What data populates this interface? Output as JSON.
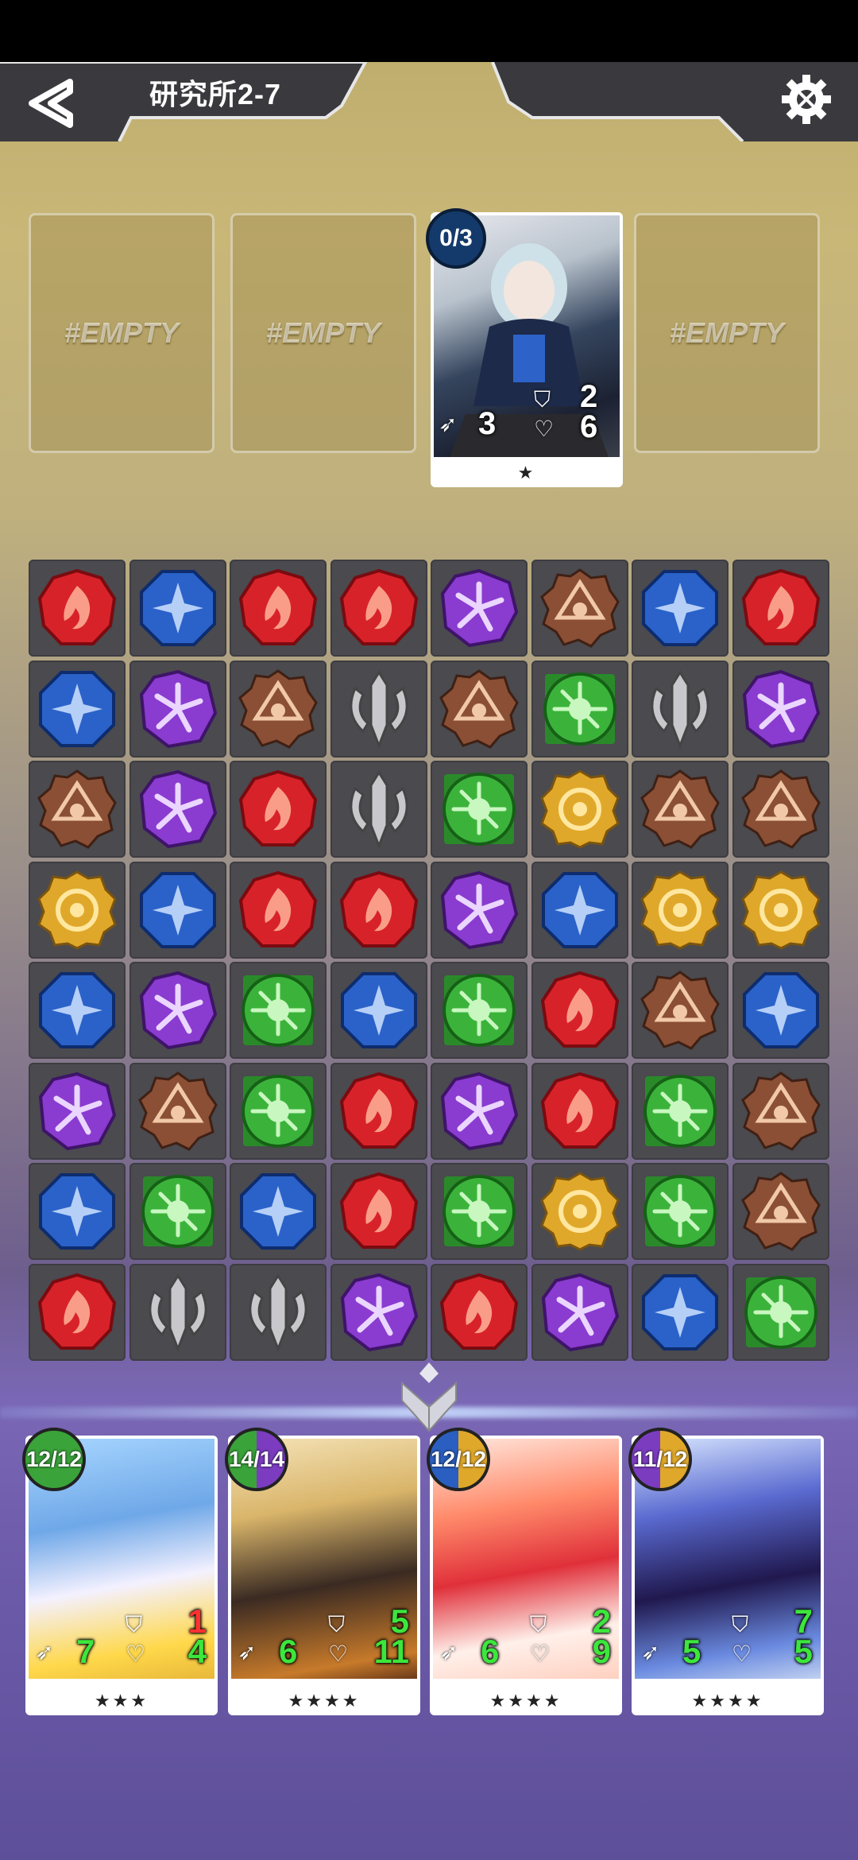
{
  "header": {
    "level_title": "研究所2-7"
  },
  "enemy_slots": [
    "#EMPTY",
    "#EMPTY",
    "enemy",
    "#EMPTY"
  ],
  "enemy": {
    "counter": "0/3",
    "shield": "2",
    "speed": "3",
    "hp": "6",
    "stars": "★"
  },
  "board": {
    "rows": [
      [
        "fire",
        "water",
        "fire",
        "fire",
        "wind",
        "earth",
        "water",
        "fire"
      ],
      [
        "water",
        "wind",
        "earth",
        "sword",
        "earth",
        "nature",
        "sword",
        "wind"
      ],
      [
        "earth",
        "wind",
        "fire",
        "sword",
        "nature",
        "light",
        "earth",
        "earth"
      ],
      [
        "light",
        "water",
        "fire",
        "fire",
        "wind",
        "water",
        "light",
        "light"
      ],
      [
        "water",
        "wind",
        "nature",
        "water",
        "nature",
        "fire",
        "earth",
        "water"
      ],
      [
        "wind",
        "earth",
        "nature",
        "fire",
        "wind",
        "fire",
        "nature",
        "earth"
      ],
      [
        "water",
        "nature",
        "water",
        "fire",
        "nature",
        "light",
        "nature",
        "earth"
      ],
      [
        "fire",
        "sword",
        "sword",
        "wind",
        "fire",
        "wind",
        "water",
        "nature"
      ]
    ]
  },
  "colors": {
    "fire": "#d8222a",
    "water": "#2a62c9",
    "wind": "#8a3bd0",
    "earth": "#8a4f35",
    "nature": "#3bb33b",
    "light": "#e0a82a",
    "sword": "#c8c8cc"
  },
  "heroes": [
    {
      "hp": "12/12",
      "shield": "1",
      "speed": "7",
      "heart": "4",
      "stars": "★★★",
      "shield_red": true,
      "badge": [
        "#3aa33a",
        "#3aa33a"
      ]
    },
    {
      "hp": "14/14",
      "shield": "5",
      "speed": "6",
      "heart": "11",
      "stars": "★★★★",
      "shield_red": false,
      "badge": [
        "#3aa33a",
        "#7b3cc0"
      ]
    },
    {
      "hp": "12/12",
      "shield": "2",
      "speed": "6",
      "heart": "9",
      "stars": "★★★★",
      "shield_red": false,
      "badge": [
        "#2a5ec0",
        "#e0a82a"
      ]
    },
    {
      "hp": "11/12",
      "shield": "7",
      "speed": "5",
      "heart": "5",
      "stars": "★★★★",
      "shield_red": false,
      "badge": [
        "#7b3cc0",
        "#e0a82a"
      ]
    }
  ]
}
